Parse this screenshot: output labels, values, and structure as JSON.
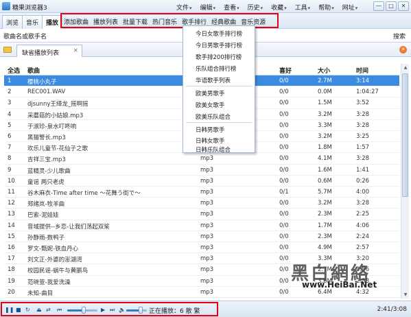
{
  "title": "糖果浏览器3",
  "menu": [
    "文件",
    "编辑",
    "查看",
    "历史",
    "收藏",
    "工具",
    "帮助",
    "网址"
  ],
  "window_buttons": [
    "—",
    "□",
    "✕"
  ],
  "toolbar": {
    "tabs": [
      "浏览",
      "音乐",
      "播放"
    ],
    "items": [
      "添加歌曲",
      "播放列表",
      "批量下载",
      "热门音乐",
      "歌手排行",
      "经典歌曲",
      "音乐资源"
    ]
  },
  "address": {
    "label": "歌曲名或歌手名",
    "search": "搜索"
  },
  "doc_tab": {
    "label": "缺省播放列表",
    "close": "×"
  },
  "dropdown": [
    "今日女歌手排行榜",
    "今日男歌手排行榜",
    "歌手排200排行榜",
    "乐队组合排行榜",
    "华语歌手列表",
    "欧美男歌手",
    "欧美女歌手",
    "欧美乐队组合",
    "日韩男歌手",
    "日韩女歌手",
    "日韩乐队组合"
  ],
  "table": {
    "headers": {
      "idx": "全选",
      "song": "歌曲",
      "like": "喜好",
      "size": "大小",
      "time": "时间"
    },
    "rows": [
      {
        "idx": "1",
        "song": "樱桃小丸子",
        "type": "",
        "like": "0/0",
        "size": "2.7M",
        "time": "3:14"
      },
      {
        "idx": "2",
        "song": "REC001.WAV",
        "type": "",
        "like": "0/0",
        "size": "0.0M",
        "time": "1:04:27"
      },
      {
        "idx": "3",
        "song": "djsunny王绎龙_摇啊摇",
        "type": "",
        "like": "0/0",
        "size": "1.5M",
        "time": "3:52"
      },
      {
        "idx": "4",
        "song": "采蘑菇的小姑娘.mp3",
        "type": "",
        "like": "0/0",
        "size": "3.2M",
        "time": "3:28"
      },
      {
        "idx": "5",
        "song": "于淑珍-泉水叮咚响",
        "type": "",
        "like": "0/0",
        "size": "3.3M",
        "time": "3:28"
      },
      {
        "idx": "6",
        "song": "黑猫警长.mp3",
        "type": "",
        "like": "0/0",
        "size": "3.2M",
        "time": "3:25"
      },
      {
        "idx": "7",
        "song": "欢乐儿童节-花仙子之歌",
        "type": "",
        "like": "0/0",
        "size": "1.8M",
        "time": "1:57"
      },
      {
        "idx": "8",
        "song": "吉祥三宝.mp3",
        "type": "mp3",
        "like": "0/0",
        "size": "4.1M",
        "time": "3:28"
      },
      {
        "idx": "9",
        "song": "蓝精灵-少儿歌曲",
        "type": "mp3",
        "like": "0/0",
        "size": "1.6M",
        "time": "1:41"
      },
      {
        "idx": "10",
        "song": "童谣 两只老虎",
        "type": "mp3",
        "like": "0/0",
        "size": "0.6M",
        "time": "0:26"
      },
      {
        "idx": "11",
        "song": "谷木麻衣-Time after time ～花舞う街で～",
        "type": "mp3",
        "like": "0/1",
        "size": "5.7M",
        "time": "4:00"
      },
      {
        "idx": "12",
        "song": "郑绪岚-牧羊曲",
        "type": "mp3",
        "like": "0/0",
        "size": "3.2M",
        "time": "3:28"
      },
      {
        "idx": "13",
        "song": "巴索-泥娃娃",
        "type": "mp3",
        "like": "0/0",
        "size": "2.3M",
        "time": "2:25"
      },
      {
        "idx": "14",
        "song": "音域提供--乡恋-让我们荡起双桨",
        "type": "mp3",
        "like": "0/0",
        "size": "1.7M",
        "time": "4:06"
      },
      {
        "idx": "15",
        "song": "孙静雨-数鸭子",
        "type": "mp3",
        "like": "0/0",
        "size": "2.3M",
        "time": "2:24"
      },
      {
        "idx": "16",
        "song": "罗文-甄妮-铁血丹心",
        "type": "mp3",
        "like": "0/0",
        "size": "4.9M",
        "time": "2:57"
      },
      {
        "idx": "17",
        "song": "刘文正-外婆的澎湖湾",
        "type": "mp3",
        "like": "0/0",
        "size": "3.3M",
        "time": "3:20"
      },
      {
        "idx": "18",
        "song": "校园民谣-蜗牛与黄鹂鸟",
        "type": "mp3",
        "like": "0/0",
        "size": "2.7M",
        "time": "2:56"
      },
      {
        "idx": "19",
        "song": "范晓萱-我爱洗澡",
        "type": "mp3",
        "like": "0/0",
        "size": "3.6M",
        "time": "2:58"
      },
      {
        "idx": "20",
        "song": "未知-曲目",
        "type": "mp3",
        "like": "0/0",
        "size": "6.4M",
        "time": "4:32"
      }
    ]
  },
  "status": {
    "now_playing": "正在播放：6 散 繁",
    "time": "2:41/3:08",
    "progress": 0.55,
    "volume": 0.7
  },
  "watermark": {
    "cn": "黑白網絡",
    "en": "www.HeiBai.Net"
  },
  "colors": {
    "selected_row": "#3c8be2",
    "highlight_box": "#e60012"
  }
}
